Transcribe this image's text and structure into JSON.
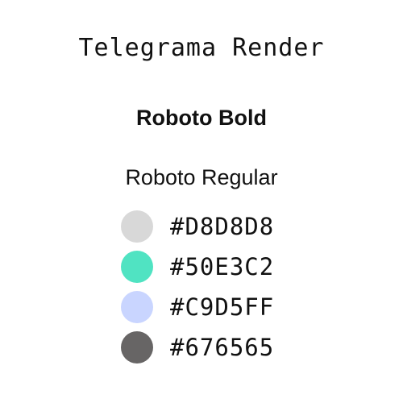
{
  "title": "Telegrama Render",
  "fonts": {
    "bold_label": "Roboto Bold",
    "regular_label": "Roboto Regular"
  },
  "swatches": [
    {
      "color": "#D8D8D8",
      "label": "#D8D8D8"
    },
    {
      "color": "#50E3C2",
      "label": "#50E3C2"
    },
    {
      "color": "#C9D5FF",
      "label": "#C9D5FF"
    },
    {
      "color": "#676565",
      "label": "#676565"
    }
  ]
}
